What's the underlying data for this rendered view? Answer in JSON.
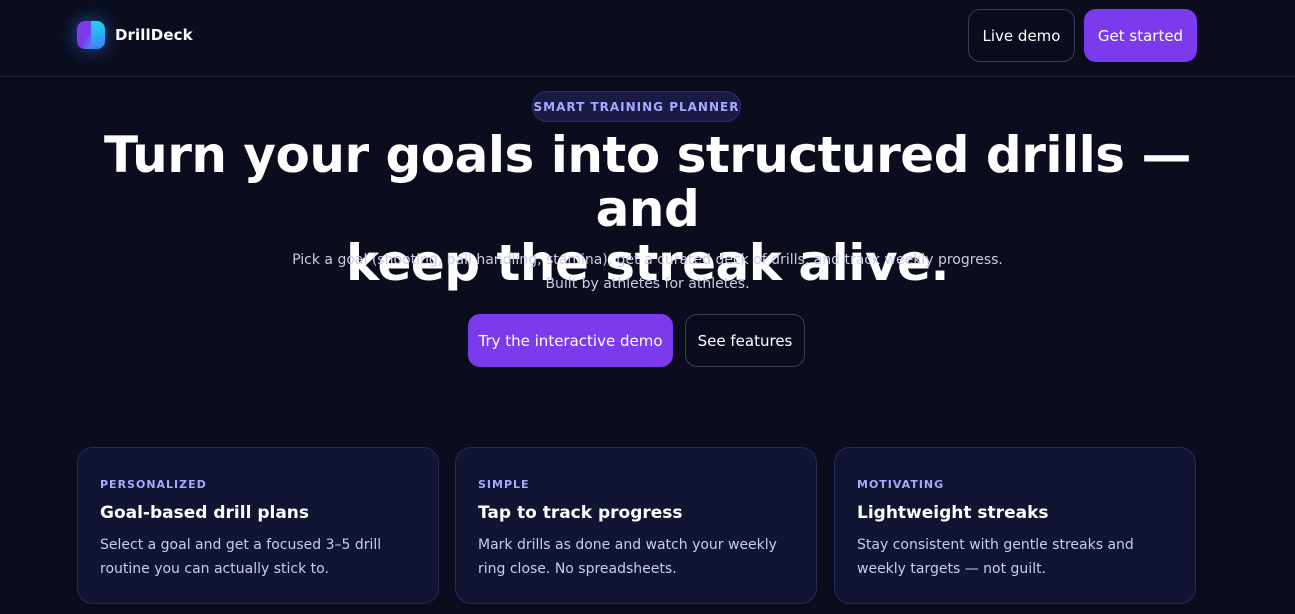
{
  "brand": {
    "name": "DrillDeck"
  },
  "nav": {
    "live_demo": "Live demo",
    "get_started": "Get started"
  },
  "hero": {
    "badge": "SMART TRAINING PLANNER",
    "headline_line1": "Turn your goals into structured drills — and",
    "headline_line2": "keep the streak alive.",
    "sub_line1": "Pick a goal (shooting, ball handling, stamina), get a curated deck of drills, and track weekly progress.",
    "sub_line2": "Built by athletes for athletes.",
    "cta_primary": "Try the interactive demo",
    "cta_secondary": "See features"
  },
  "cards": [
    {
      "kicker": "PERSONALIZED",
      "title": "Goal-based drill plans",
      "body": "Select a goal and get a focused 3–5 drill routine you can actually stick to."
    },
    {
      "kicker": "SIMPLE",
      "title": "Tap to track progress",
      "body": "Mark drills as done and watch your weekly ring close. No spreadsheets."
    },
    {
      "kicker": "MOTIVATING",
      "title": "Lightweight streaks",
      "body": "Stay consistent with gentle streaks and weekly targets — not guilt."
    }
  ],
  "colors": {
    "background": "#0b0d1f",
    "accent": "#7c3aed",
    "kicker": "#a5a8ff"
  }
}
